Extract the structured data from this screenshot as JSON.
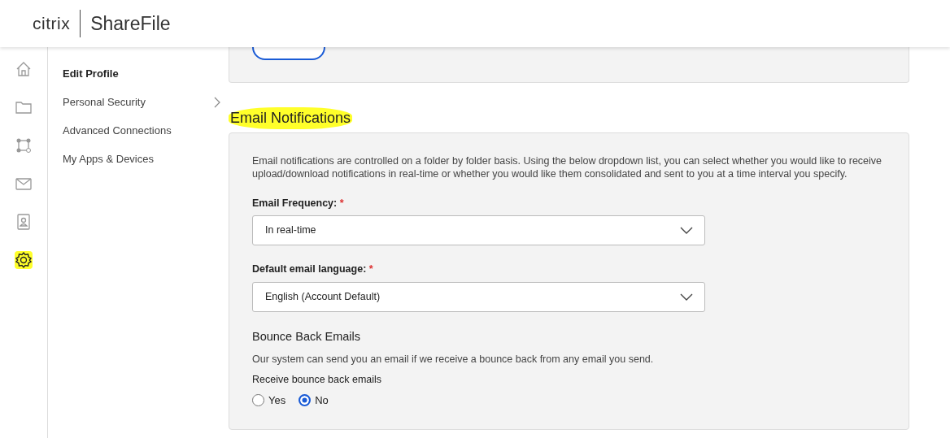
{
  "header": {
    "brand": "citrix",
    "product": "ShareFile"
  },
  "rail": [
    {
      "highlighted": false
    },
    {
      "highlighted": false
    },
    {
      "highlighted": false
    },
    {
      "highlighted": false
    },
    {
      "highlighted": false
    },
    {
      "highlighted": true
    }
  ],
  "submenu": [
    {
      "label": "Edit Profile",
      "selected": true,
      "has_children": false
    },
    {
      "label": "Personal Security",
      "selected": false,
      "has_children": true
    },
    {
      "label": "Advanced Connections",
      "selected": false,
      "has_children": false
    },
    {
      "label": "My Apps & Devices",
      "selected": false,
      "has_children": false
    }
  ],
  "section": {
    "title": "Email Notifications",
    "highlighted": true,
    "description": "Email notifications are controlled on a folder by folder basis. Using the below dropdown list, you can select whether you would like to receive upload/download notifications in real-time or whether you would like them consolidated and sent to you at a time interval you specify.",
    "fields": [
      {
        "label": "Email Frequency:",
        "required_mark": "*",
        "value": "In real-time"
      },
      {
        "label": "Default email language:",
        "required_mark": "*",
        "value": "English (Account Default)"
      }
    ],
    "bounce": {
      "title": "Bounce Back Emails",
      "description": "Our system can send you an email if we receive a bounce back from any email you send.",
      "question": "Receive bounce back emails",
      "options": [
        {
          "label": "Yes",
          "selected": false
        },
        {
          "label": "No",
          "selected": true
        }
      ]
    }
  }
}
